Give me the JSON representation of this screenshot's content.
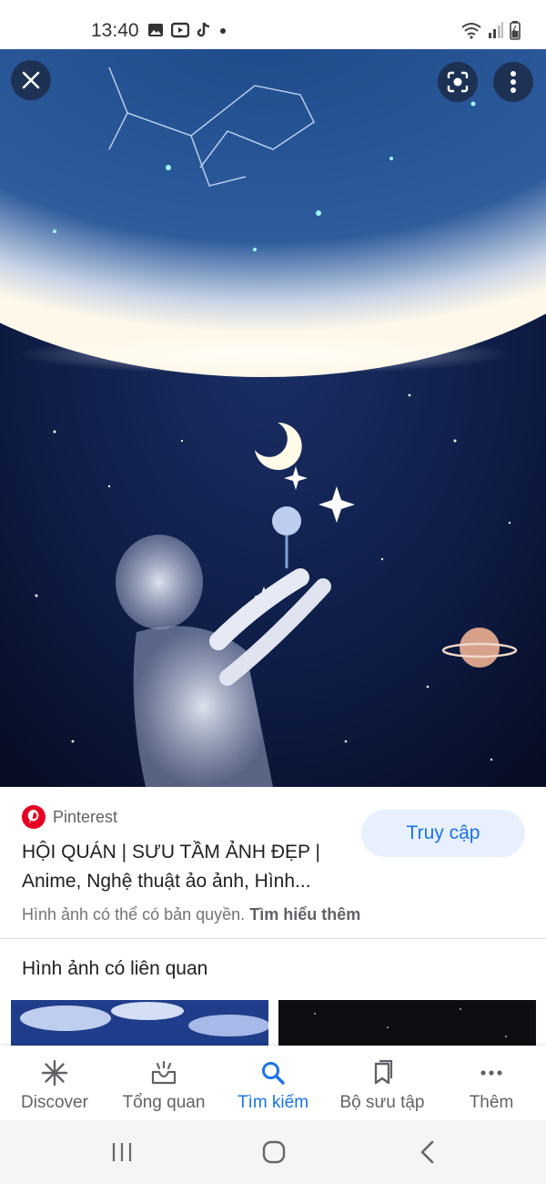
{
  "status_bar": {
    "time": "13:40",
    "left_icons": [
      "image-icon",
      "youtube-icon",
      "tiktok-icon",
      "dot-icon"
    ],
    "right_icons": [
      "wifi-icon",
      "signal-icon",
      "battery-icon"
    ]
  },
  "hero": {
    "image_subject": "anime boy reaching toward starry planet sky",
    "buttons": [
      "close-icon",
      "lens-icon",
      "more-vert-icon"
    ]
  },
  "result": {
    "source": "Pinterest",
    "title": "HỘI QUÁN | SƯU TẦM ẢNH ĐẸP | Anime, Nghệ thuật ảo ảnh, Hình...",
    "visit_label": "Truy cập",
    "copyright_text": "Hình ảnh có thể có bản quyền.",
    "learn_more": "Tìm hiểu thêm"
  },
  "related": {
    "title": "Hình ảnh có liên quan"
  },
  "bottom_nav": {
    "items": [
      {
        "label": "Discover",
        "icon": "asterisk-icon",
        "active": false
      },
      {
        "label": "Tổng quan",
        "icon": "inbox-icon",
        "active": false
      },
      {
        "label": "Tìm kiếm",
        "icon": "search-icon",
        "active": true
      },
      {
        "label": "Bộ sưu tập",
        "icon": "collections-icon",
        "active": false
      },
      {
        "label": "Thêm",
        "icon": "more-horiz-icon",
        "active": false
      }
    ]
  },
  "colors": {
    "accent": "#1a73e8",
    "visit_bg": "#e8f0fe",
    "pinterest": "#e60023"
  }
}
